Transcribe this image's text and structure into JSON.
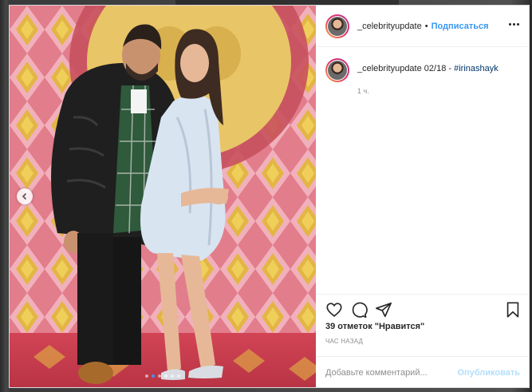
{
  "post": {
    "username": "_celebrityupdate",
    "separator": "•",
    "follow_label": "Подписаться",
    "caption_prefix": "02/18 -",
    "caption_hashtag": "#irinashayk",
    "caption_time": "1 ч.",
    "likes": "39 отметок \"Нравится\"",
    "time_ago": "ЧАС НАЗАД",
    "comment_placeholder": "Добавьте комментарий...",
    "publish_label": "Опубликовать"
  },
  "carousel": {
    "dots": 6,
    "active_index": 1
  },
  "colors": {
    "accent": "#3897f0",
    "publish_disabled": "#b2dffc",
    "hashtag": "#00376b"
  },
  "icons": [
    "more-options-icon",
    "heart-icon",
    "comment-icon",
    "share-icon",
    "bookmark-icon",
    "chevron-left-icon"
  ]
}
